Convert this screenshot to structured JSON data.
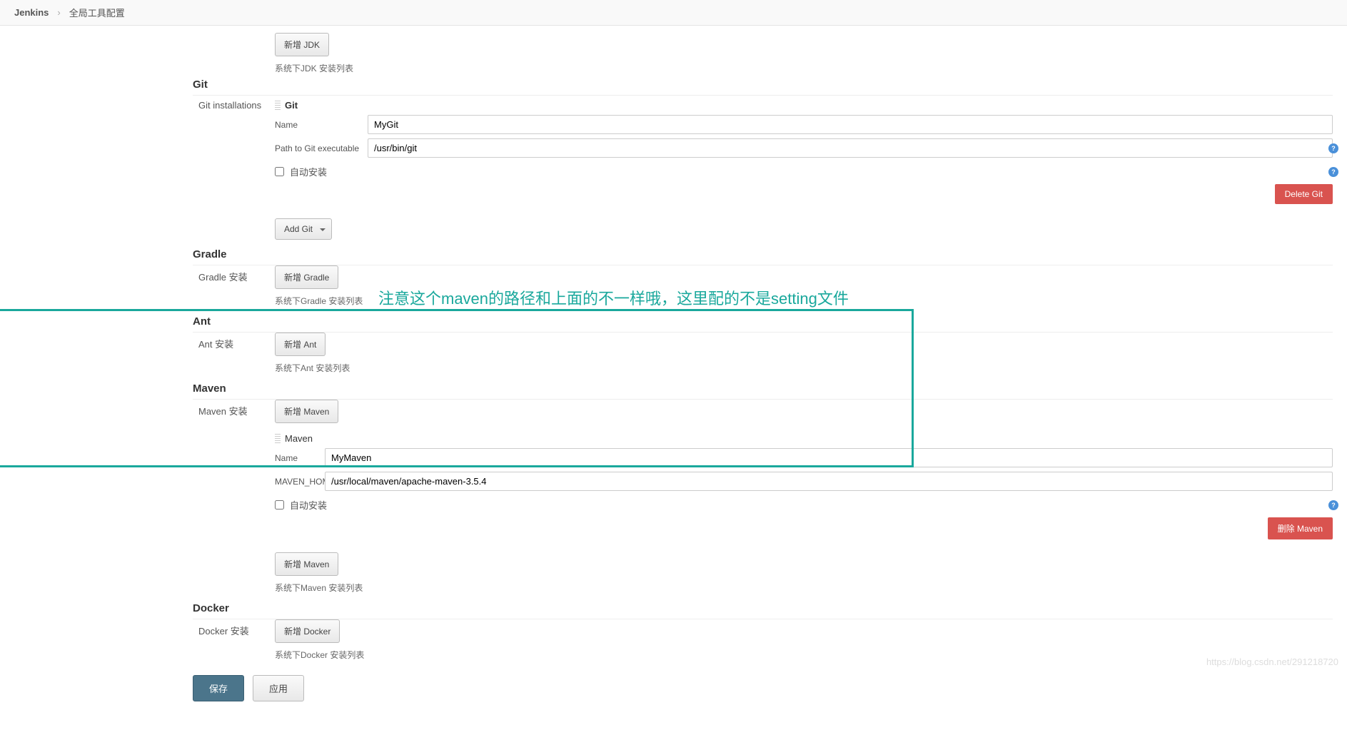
{
  "breadcrumb": {
    "root": "Jenkins",
    "current": "全局工具配置"
  },
  "jdk": {
    "add_button": "新增 JDK",
    "hint": "系统下JDK 安装列表"
  },
  "git": {
    "heading": "Git",
    "subheading": "Git installations",
    "entry_title": "Git",
    "name_label": "Name",
    "name_value": "MyGit",
    "path_label": "Path to Git executable",
    "path_value": "/usr/bin/git",
    "auto_install": "自动安装",
    "delete_button": "Delete Git",
    "add_button": "Add Git"
  },
  "gradle": {
    "heading": "Gradle",
    "subheading": "Gradle 安装",
    "add_button": "新增 Gradle",
    "hint": "系统下Gradle 安装列表"
  },
  "ant": {
    "heading": "Ant",
    "subheading": "Ant 安装",
    "add_button": "新增 Ant",
    "hint": "系统下Ant 安装列表"
  },
  "maven": {
    "heading": "Maven",
    "subheading": "Maven 安装",
    "add_button_top": "新增 Maven",
    "entry_title": "Maven",
    "name_label": "Name",
    "name_value": "MyMaven",
    "home_label": "MAVEN_HOME",
    "home_value": "/usr/local/maven/apache-maven-3.5.4",
    "auto_install": "自动安装",
    "delete_button": "删除 Maven",
    "add_button_bottom": "新增 Maven",
    "hint": "系统下Maven 安装列表"
  },
  "docker": {
    "heading": "Docker",
    "subheading": "Docker 安装",
    "add_button": "新增 Docker",
    "hint": "系统下Docker 安装列表"
  },
  "footer": {
    "save": "保存",
    "apply": "应用"
  },
  "annotation": "注意这个maven的路径和上面的不一样哦，这里配的不是setting文件",
  "watermark": "https://blog.csdn.net/291218720"
}
